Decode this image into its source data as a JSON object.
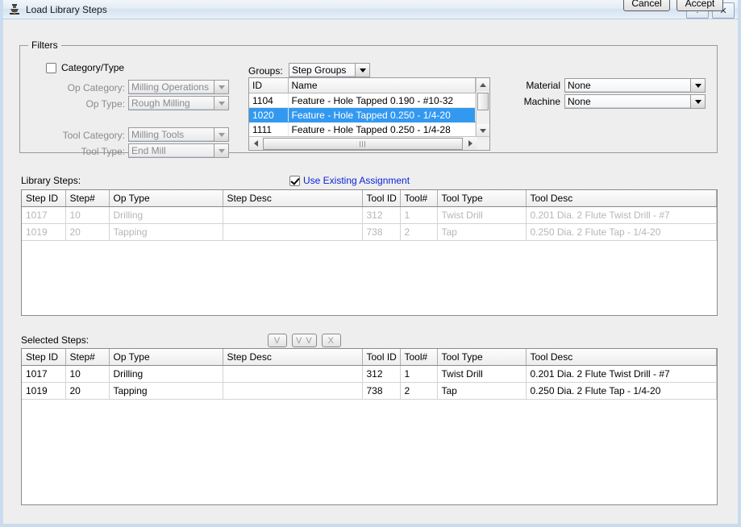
{
  "window": {
    "title": "Load Library Steps",
    "icon": "machine-icon",
    "help_label": "?",
    "close_label": "✕"
  },
  "filters": {
    "legend": "Filters",
    "category_type_checkbox": {
      "label": "Category/Type",
      "checked": false
    },
    "fields": [
      {
        "label": "Op Category:",
        "value": "Milling Operations",
        "enabled": false
      },
      {
        "label": "Op Type:",
        "value": "Rough Milling",
        "enabled": false
      },
      {
        "label": "Tool Category:",
        "value": "Milling Tools",
        "enabled": false
      },
      {
        "label": "Tool Type:",
        "value": "End Mill",
        "enabled": false
      }
    ],
    "groups": {
      "label": "Groups:",
      "selected": "Step Groups",
      "columns": [
        "ID",
        "Name"
      ],
      "rows": [
        {
          "id": "1104",
          "name": "Feature - Hole Tapped 0.190 - #10-32",
          "selected": false
        },
        {
          "id": "1020",
          "name": "Feature - Hole Tapped 0.250 - 1/4-20",
          "selected": true
        },
        {
          "id": "1111",
          "name": "Feature - Hole Tapped 0.250 - 1/4-28",
          "selected": false
        }
      ]
    },
    "material": {
      "label": "Material",
      "value": "None"
    },
    "machine": {
      "label": "Machine",
      "value": "None"
    }
  },
  "library_steps": {
    "label": "Library Steps:",
    "use_existing_assignment": {
      "label": "Use Existing Assignment",
      "checked": true
    },
    "columns": [
      "Step ID",
      "Step#",
      "Op Type",
      "Step Desc",
      "Tool ID",
      "Tool#",
      "Tool Type",
      "Tool Desc"
    ],
    "rows": [
      [
        "1017",
        "10",
        "Drilling",
        "",
        "312",
        "1",
        "Twist Drill",
        "0.201 Dia. 2 Flute Twist Drill - #7"
      ],
      [
        "1019",
        "20",
        "Tapping",
        "",
        "738",
        "2",
        "Tap",
        "0.250 Dia. 2 Flute Tap - 1/4-20"
      ]
    ]
  },
  "transfer_buttons": [
    {
      "label": "V",
      "name": "move-one-button"
    },
    {
      "label": "V V",
      "name": "move-all-button"
    },
    {
      "label": "X",
      "name": "remove-button"
    }
  ],
  "selected_steps": {
    "label": "Selected Steps:",
    "columns": [
      "Step ID",
      "Step#",
      "Op Type",
      "Step Desc",
      "Tool ID",
      "Tool#",
      "Tool Type",
      "Tool Desc"
    ],
    "rows": [
      [
        "1017",
        "10",
        "Drilling",
        "",
        "312",
        "1",
        "Twist Drill",
        "0.201 Dia. 2 Flute Twist Drill - #7"
      ],
      [
        "1019",
        "20",
        "Tapping",
        "",
        "738",
        "2",
        "Tap",
        "0.250 Dia. 2 Flute Tap - 1/4-20"
      ]
    ]
  },
  "footer": {
    "cancel_label": "Cancel",
    "accept_label": "Accept"
  },
  "colors": {
    "selection_blue": "#3399f0",
    "link_blue": "#0b24d8",
    "dialog_bg": "#eeeeee",
    "disabled_text": "#b6b6b6"
  }
}
